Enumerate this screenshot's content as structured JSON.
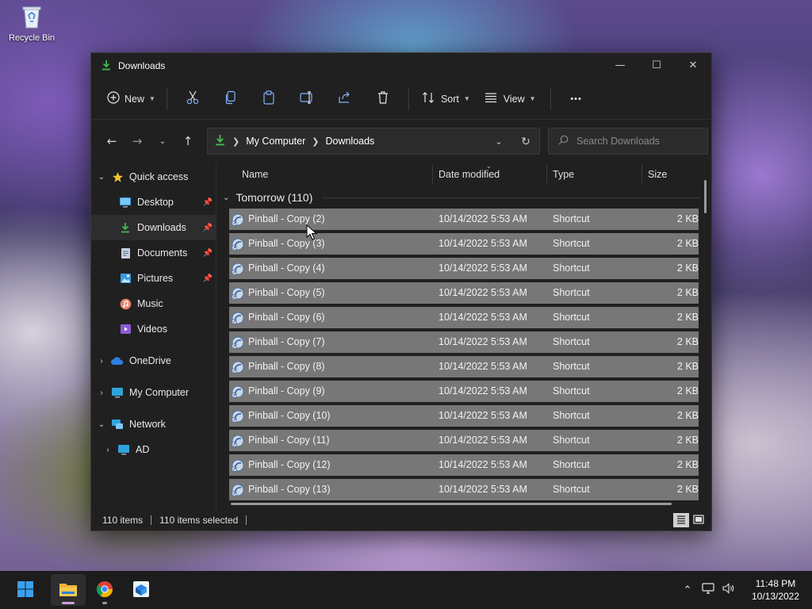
{
  "desktop": {
    "recycle_bin_label": "Recycle Bin"
  },
  "window": {
    "title": "Downloads",
    "controls": {
      "minimize": "—",
      "maximize": "☐",
      "close": "✕"
    }
  },
  "toolbar": {
    "new_label": "New",
    "sort_label": "Sort",
    "view_label": "View",
    "more_label": "•••"
  },
  "address": {
    "crumbs": [
      "My Computer",
      "Downloads"
    ]
  },
  "search": {
    "placeholder": "Search Downloads"
  },
  "sidebar": {
    "quick_access": "Quick access",
    "items": [
      {
        "label": "Desktop",
        "icon": "desktop-icon",
        "pinned": true
      },
      {
        "label": "Downloads",
        "icon": "downloads-icon",
        "pinned": true,
        "selected": true
      },
      {
        "label": "Documents",
        "icon": "documents-icon",
        "pinned": true
      },
      {
        "label": "Pictures",
        "icon": "pictures-icon",
        "pinned": true
      },
      {
        "label": "Music",
        "icon": "music-icon"
      },
      {
        "label": "Videos",
        "icon": "videos-icon"
      }
    ],
    "onedrive": "OneDrive",
    "my_computer": "My Computer",
    "network": "Network",
    "ad": "AD"
  },
  "columns": {
    "name": "Name",
    "date": "Date modified",
    "type": "Type",
    "size": "Size"
  },
  "group": {
    "label": "Tomorrow (110)"
  },
  "files": [
    {
      "name": "Pinball - Copy (2)",
      "date": "10/14/2022 5:53 AM",
      "type": "Shortcut",
      "size": "2 KB"
    },
    {
      "name": "Pinball - Copy (3)",
      "date": "10/14/2022 5:53 AM",
      "type": "Shortcut",
      "size": "2 KB"
    },
    {
      "name": "Pinball - Copy (4)",
      "date": "10/14/2022 5:53 AM",
      "type": "Shortcut",
      "size": "2 KB"
    },
    {
      "name": "Pinball - Copy (5)",
      "date": "10/14/2022 5:53 AM",
      "type": "Shortcut",
      "size": "2 KB"
    },
    {
      "name": "Pinball - Copy (6)",
      "date": "10/14/2022 5:53 AM",
      "type": "Shortcut",
      "size": "2 KB"
    },
    {
      "name": "Pinball - Copy (7)",
      "date": "10/14/2022 5:53 AM",
      "type": "Shortcut",
      "size": "2 KB"
    },
    {
      "name": "Pinball - Copy (8)",
      "date": "10/14/2022 5:53 AM",
      "type": "Shortcut",
      "size": "2 KB"
    },
    {
      "name": "Pinball - Copy (9)",
      "date": "10/14/2022 5:53 AM",
      "type": "Shortcut",
      "size": "2 KB"
    },
    {
      "name": "Pinball - Copy (10)",
      "date": "10/14/2022 5:53 AM",
      "type": "Shortcut",
      "size": "2 KB"
    },
    {
      "name": "Pinball - Copy (11)",
      "date": "10/14/2022 5:53 AM",
      "type": "Shortcut",
      "size": "2 KB"
    },
    {
      "name": "Pinball - Copy (12)",
      "date": "10/14/2022 5:53 AM",
      "type": "Shortcut",
      "size": "2 KB"
    },
    {
      "name": "Pinball - Copy (13)",
      "date": "10/14/2022 5:53 AM",
      "type": "Shortcut",
      "size": "2 KB"
    }
  ],
  "status": {
    "items": "110 items",
    "selected": "110 items selected"
  },
  "taskbar": {
    "time": "11:48 PM",
    "date": "10/13/2022"
  },
  "colors": {
    "accent_green": "#3fb950",
    "selection_row": "#777777",
    "window_bg": "#202020"
  }
}
